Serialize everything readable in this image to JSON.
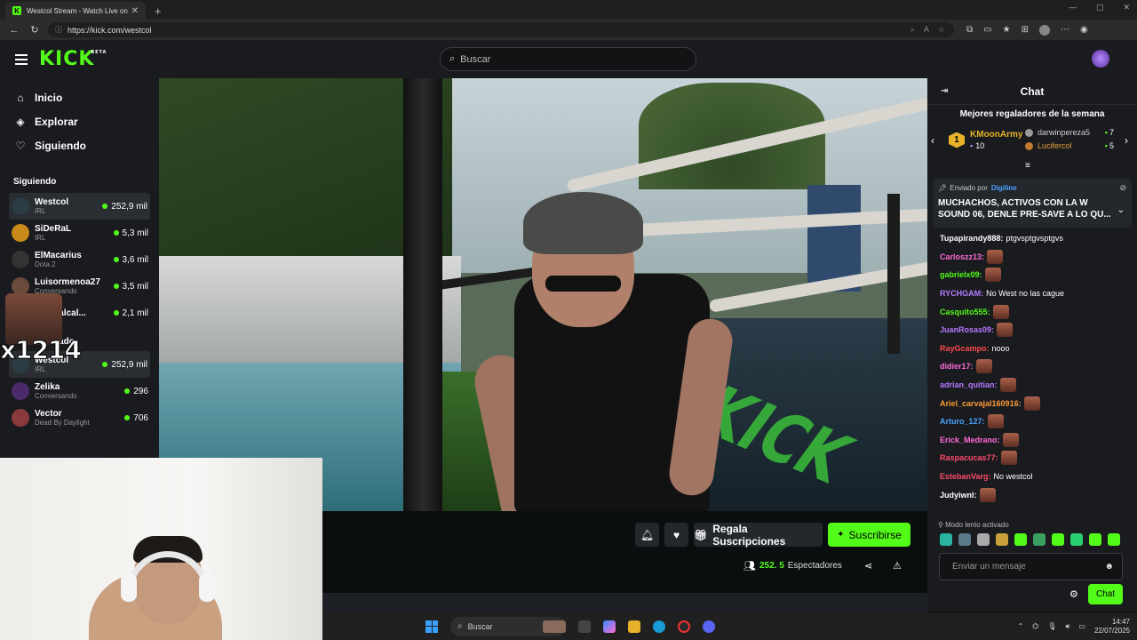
{
  "browser": {
    "tab_title": "Westcol Stream - Watch Live on K",
    "url": "https://kick.com/westcol"
  },
  "header": {
    "logo": "KICK",
    "beta": "BETA",
    "search_placeholder": "Buscar"
  },
  "sidebar": {
    "nav": [
      {
        "label": "Inicio",
        "icon": "home-icon"
      },
      {
        "label": "Explorar",
        "icon": "compass-icon"
      },
      {
        "label": "Siguiendo",
        "icon": "heart-icon"
      }
    ],
    "following_title": "Siguiendo",
    "following": [
      {
        "name": "Westcol",
        "category": "IRL",
        "viewers": "252,9 mil",
        "color": "#2c3c44"
      },
      {
        "name": "SiDeRaL",
        "category": "IRL",
        "viewers": "5,3 mil",
        "color": "#c98a1a"
      },
      {
        "name": "ElMacarius",
        "category": "Dota 2",
        "viewers": "3,6 mil",
        "color": "#333333"
      },
      {
        "name": "Luisormenoa27",
        "category": "Conversando",
        "viewers": "3,5 mil",
        "color": "#6a4a3a"
      },
      {
        "name": "Davidalcal...",
        "category": "",
        "viewers": "2,1 mil",
        "color": "#555555"
      }
    ],
    "recommended_title": "Recomendado",
    "recommended": [
      {
        "name": "Westcol",
        "category": "IRL",
        "viewers": "252,9 mil",
        "color": "#2c3c44"
      },
      {
        "name": "Zelika",
        "category": "Conversando",
        "viewers": "296",
        "color": "#4a2a6a"
      },
      {
        "name": "Vector",
        "category": "Dead By Daylight",
        "viewers": "706",
        "color": "#8a3a3a"
      }
    ]
  },
  "overlay": {
    "combo": "x1214"
  },
  "stream_actions": {
    "gift_label": "Regala Suscripciones",
    "subscribe_label": "Suscribirse",
    "viewers_count": "252. 5",
    "viewers_label": "Espectadores"
  },
  "chat": {
    "title": "Chat",
    "gifters_title": "Mejores regaladores de la semana",
    "top_gifter": {
      "rank": "1",
      "name": "KMoonArmy",
      "count": "10"
    },
    "gifters": [
      {
        "name": "darwinpereza5",
        "count": "7",
        "color": "#cfcfcf",
        "icon_color": "#9a9a9a"
      },
      {
        "name": "Lucifercol",
        "count": "5",
        "color": "#e7a03a",
        "icon_color": "#c07a30"
      }
    ],
    "pinned": {
      "by_label": "Enviado por",
      "by_name": "Digiline",
      "message": "MUCHACHOS, ACTIVOS CON LA W SOUND 06, DENLE PRE-SAVE A LO QU..."
    },
    "messages": [
      {
        "user": "Tupapirandy888:",
        "text": "ptgvsptgvsptgvs",
        "color": "#ffffff",
        "emote": false
      },
      {
        "user": "Carloszz13:",
        "text": "",
        "color": "#ff6ad5",
        "emote": true
      },
      {
        "user": "gabrielx09:",
        "text": "",
        "color": "#53fc18",
        "emote": true
      },
      {
        "user": "RYCHGAM:",
        "text": "No West no las cague",
        "color": "#b57aff",
        "emote": false
      },
      {
        "user": "Casquito555:",
        "text": "",
        "color": "#53fc18",
        "emote": true
      },
      {
        "user": "JuanRosas09:",
        "text": "",
        "color": "#b57aff",
        "emote": true
      },
      {
        "user": "RayGcampo:",
        "text": "nooo",
        "color": "#ff4a4a",
        "emote": false
      },
      {
        "user": "didier17:",
        "text": "",
        "color": "#ff6ad5",
        "emote": true
      },
      {
        "user": "adrian_quitian:",
        "text": "",
        "color": "#b57aff",
        "emote": true
      },
      {
        "user": "Ariel_carvajal160916:",
        "text": "",
        "color": "#ff9a3a",
        "emote": true
      },
      {
        "user": "Arturo_127:",
        "text": "",
        "color": "#4aa3ff",
        "emote": true
      },
      {
        "user": "Erick_Medrano:",
        "text": "",
        "color": "#ff6ad5",
        "emote": true
      },
      {
        "user": "Raspacucas77:",
        "text": "",
        "color": "#ff4a6a",
        "emote": true
      },
      {
        "user": "EstebanVarg:",
        "text": "No westcol",
        "color": "#ff4a6a",
        "emote": false
      },
      {
        "user": "Judyiwnl:",
        "text": "",
        "color": "#ffffff",
        "emote": true
      }
    ],
    "slow_mode": "Modo lento activado",
    "input_placeholder": "Enviar un mensaje",
    "send_label": "Chat"
  },
  "taskbar": {
    "search_placeholder": "Buscar",
    "time": "14:47",
    "date": "22/07/2025"
  },
  "colors": {
    "brand": "#53fc18",
    "bg": "#0b0e0f",
    "panel": "#191b1f"
  }
}
